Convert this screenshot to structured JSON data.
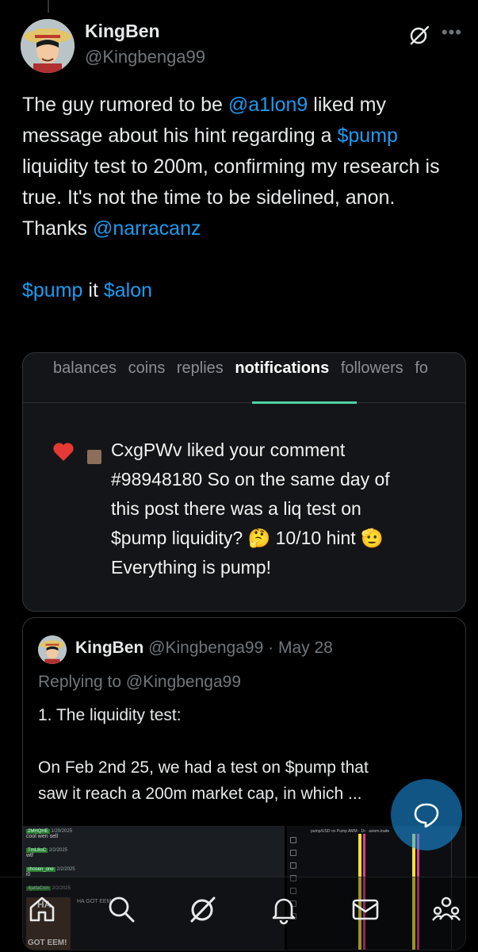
{
  "author": {
    "display_name": "KingBen",
    "handle": "@Kingbenga99"
  },
  "tweet": {
    "p1": "The guy rumored to be ",
    "mention1": "@a1lon9",
    "p2": "  liked my message about his hint regarding a ",
    "cashtag1": "$pump",
    "p3": " liquidity test to 200m, confirming my research is true. It's not the time to be sidelined, anon. Thanks ",
    "mention2": "@narracanz",
    "cashtag2": "$pump",
    "p4": " it ",
    "cashtag3": "$alon"
  },
  "media_card": {
    "tabs": [
      "balances",
      "coins",
      "replies",
      "notifications",
      "followers",
      "fo"
    ],
    "active_tab": "notifications",
    "notification": {
      "line1": "CxgPWv liked your comment",
      "line2": "#98948180 So on the same day of",
      "line3": "this post there was a liq test on",
      "line4": "$pump liquidity? 🤔 10/10 hint 🫡",
      "line5": "Everything is pump!"
    }
  },
  "quote": {
    "display_name": "KingBen",
    "handle": "@Kingbenga99",
    "separator": "·",
    "date": "May 28",
    "replying": "Replying to @Kingbenga99",
    "line1": "1. The liquidity test:",
    "line2": "On Feb 2nd 25, we had a test on $pump that",
    "line3": "saw it reach a 200m market cap, in which ...",
    "thumb_left": {
      "rows": [
        {
          "user": "2MHQHE",
          "date": "1/29/2025",
          "text": "cool wen sell"
        },
        {
          "user": "TmL8oC",
          "date": "2/2/2025",
          "text": "wtf"
        },
        {
          "user": "chosen_one",
          "date": "2/2/2025",
          "text": "i0"
        },
        {
          "user": "4jatfaCoin",
          "date": "2/2/2025",
          "text": "HA GOT EEM!"
        }
      ],
      "meme_top": "HA",
      "meme_bottom": "GOT EEM!"
    },
    "thumb_right": {
      "title": "pump/USD on Pump AMM · 1h · axiom.trade"
    }
  },
  "colors": {
    "link": "#1d9bf0",
    "accent_underline": "#4fd1a5",
    "background": "#000000"
  },
  "icons": [
    "grok-icon",
    "more-icon",
    "heart-icon",
    "reply-fab-icon",
    "home-icon",
    "search-icon",
    "grok-nav-icon",
    "notifications-icon",
    "messages-icon",
    "communities-icon"
  ]
}
